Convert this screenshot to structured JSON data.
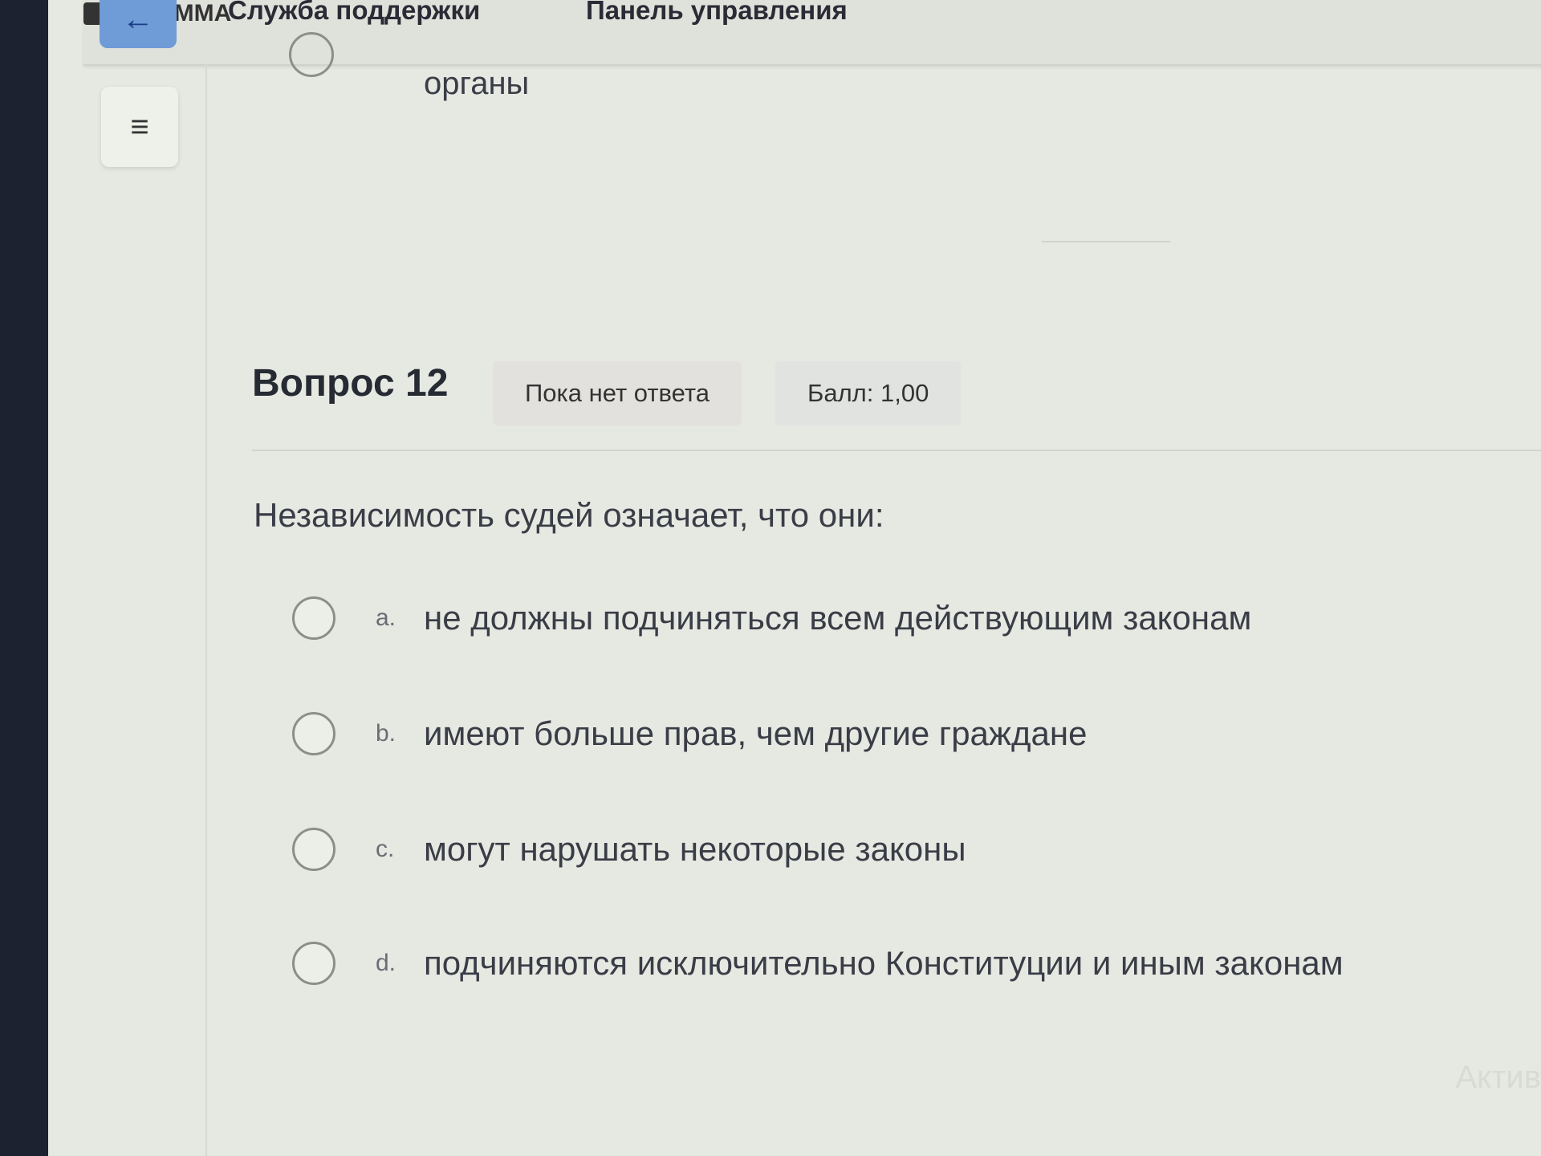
{
  "topbar": {
    "support_label": "Служба поддержки",
    "dashboard_label": "Панель управления",
    "site_label": "ЭОС ММА"
  },
  "previous": {
    "answer_text": "органы"
  },
  "question": {
    "title": "Вопрос 12",
    "status": "Пока нет ответа",
    "score": "Балл: 1,00",
    "text": "Независимость судей означает, что они:",
    "options": [
      {
        "letter": "a.",
        "text": "не должны подчиняться всем действующим законам"
      },
      {
        "letter": "b.",
        "text": "имеют больше прав, чем другие граждане"
      },
      {
        "letter": "c.",
        "text": "могут нарушать некоторые законы"
      },
      {
        "letter": "d.",
        "text": "подчиняются исключительно Конституции и иным законам"
      }
    ]
  },
  "watermark": "Актив"
}
